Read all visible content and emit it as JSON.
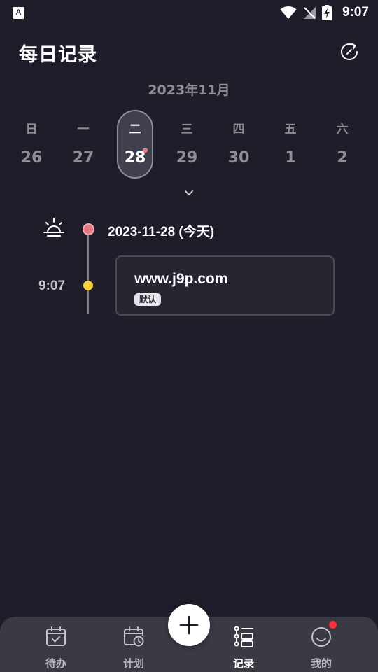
{
  "status_bar": {
    "app_icon_letter": "A",
    "time": "9:07",
    "icons": [
      "wifi-icon",
      "no-signal-icon",
      "battery-charging-icon"
    ]
  },
  "header": {
    "title": "每日记录",
    "refresh_icon": "refresh-icon"
  },
  "calendar": {
    "month": "2023年11月",
    "days": [
      {
        "name": "日",
        "number": "26",
        "selected": false
      },
      {
        "name": "一",
        "number": "27",
        "selected": false
      },
      {
        "name": "二",
        "number": "28",
        "selected": true,
        "has_dot": true
      },
      {
        "name": "三",
        "number": "29",
        "selected": false
      },
      {
        "name": "四",
        "number": "30",
        "selected": false
      },
      {
        "name": "五",
        "number": "1",
        "selected": false
      },
      {
        "name": "六",
        "number": "2",
        "selected": false
      }
    ],
    "expand_icon": "chevron-down-icon"
  },
  "timeline": {
    "date_icon": "sunrise-icon",
    "date_label": "2023-11-28 (今天)",
    "entries": [
      {
        "time": "9:07",
        "title": "www.j9p.com",
        "tag": "默认"
      }
    ]
  },
  "bottom_nav": {
    "items": [
      {
        "label": "待办",
        "icon": "calendar-check-icon",
        "active": false
      },
      {
        "label": "计划",
        "icon": "calendar-clock-icon",
        "active": false
      },
      {
        "label": "记录",
        "icon": "list-icon",
        "active": true
      },
      {
        "label": "我的",
        "icon": "smile-icon",
        "active": false,
        "badge": true
      }
    ],
    "add_icon": "plus-icon"
  },
  "colors": {
    "background": "#1e1e2a",
    "nav_background": "#3a3a44",
    "today_dot": "#e27a87",
    "entry_dot": "#f6d23c",
    "badge": "#ff2f3d"
  }
}
